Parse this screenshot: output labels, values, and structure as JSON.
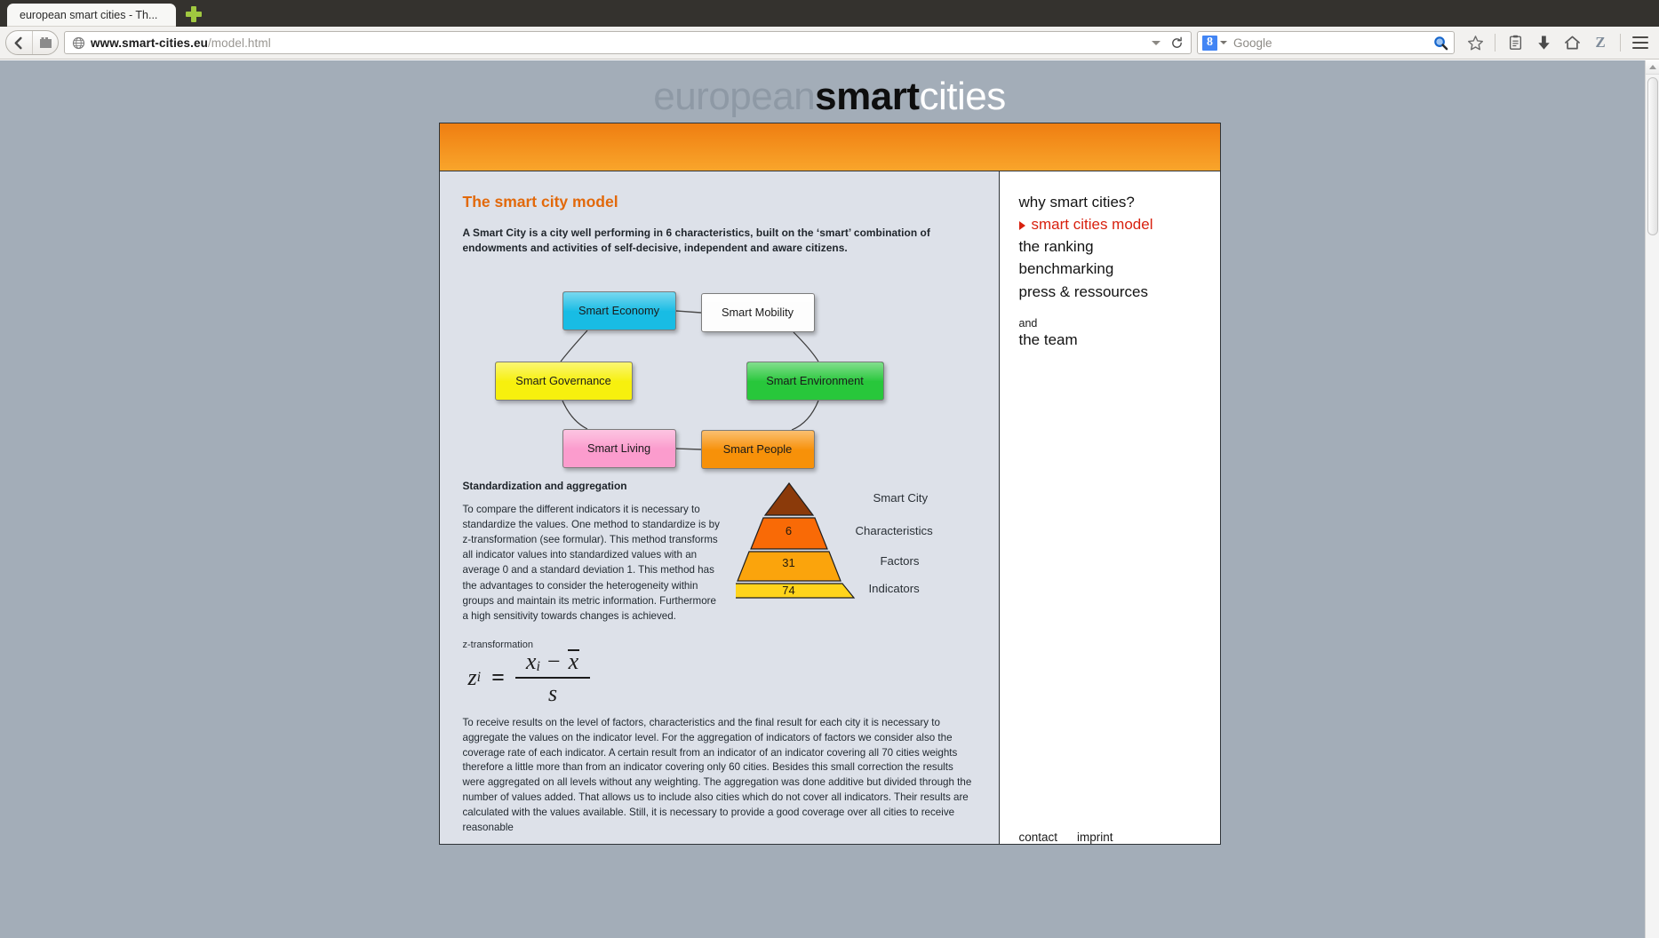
{
  "browser": {
    "tab_title": "european smart cities - Th...",
    "new_tab_label": "+",
    "url_host": "www.smart-cities.eu",
    "url_path": "/model.html",
    "search_engine": "Google",
    "search_placeholder": "Google",
    "icons": {
      "back": "back-arrow-icon",
      "site_identity": "site-identity-icon",
      "globe": "globe-icon",
      "reload": "reload-icon",
      "magnifier": "search-icon",
      "bookmark": "star-icon",
      "reading_list": "reading-list-icon",
      "downloads": "download-arrow-icon",
      "home": "home-icon",
      "zotero": "Z",
      "menu": "hamburger-menu-icon"
    }
  },
  "site": {
    "logo": {
      "part1": "european",
      "part2": "smart",
      "part3": "cities"
    }
  },
  "main": {
    "title": "The smart city model",
    "intro": "A Smart City is a city well performing in 6 characteristics, built on the ‘smart’ combination of endowments and activities of self-decisive, independent and aware citizens.",
    "diagram": {
      "nodes": [
        {
          "label": "Smart Economy",
          "color": "#18bce4"
        },
        {
          "label": "Smart Mobility",
          "color": "#fdfdfd"
        },
        {
          "label": "Smart Governance",
          "color": "#f7f00e"
        },
        {
          "label": "Smart Environment",
          "color": "#28c73b"
        },
        {
          "label": "Smart Living",
          "color": "#fb9ccd"
        },
        {
          "label": "Smart People",
          "color": "#f79109"
        }
      ]
    },
    "standardization": {
      "heading": "Standardization and aggregation",
      "paragraph": "To compare the different indicators it is necessary to standardize the values. One method to standardize is by z-transformation (see formular). This method transforms all indicator values into standardized values with an average 0 and a standard deviation 1. This method has the advantages to consider the heterogeneity within groups and maintain its metric information. Furthermore a high sensitivity towards changes is achieved."
    },
    "pyramid": {
      "levels": [
        {
          "value": "",
          "label": "Smart City",
          "color": "#8b3a0a"
        },
        {
          "value": "6",
          "label": "Characteristics",
          "color": "#f96a06"
        },
        {
          "value": "31",
          "label": "Factors",
          "color": "#fba40c"
        },
        {
          "value": "74",
          "label": "Indicators",
          "color": "#ffd41b"
        }
      ]
    },
    "formula": {
      "caption": "z-transformation",
      "z": "z",
      "z_sub": "i",
      "equals": "=",
      "numerator_x": "x",
      "numerator_sub": "i",
      "minus": "−",
      "numerator_mean": "x",
      "denominator": "s"
    },
    "tail_paragraph": "To receive results on the level of factors, characteristics and the final result for each city it is necessary to aggregate the values on the indicator level. For the aggregation of indicators of factors we consider also the coverage rate of each indicator. A certain result from an indicator of an indicator covering all 70 cities weights therefore a little more than from an indicator covering only 60 cities. Besides this small correction the results were aggregated on all levels without any weighting. The aggregation was done additive but divided through the number of values added. That allows us to include also cities which do not cover all indicators. Their results are calculated with the values available. Still, it is necessary to provide a good coverage over all cities to receive reasonable"
  },
  "sidebar": {
    "items": [
      {
        "label": "why smart cities?",
        "active": false
      },
      {
        "label": "smart cities model",
        "active": true
      },
      {
        "label": "the ranking",
        "active": false
      },
      {
        "label": "benchmarking",
        "active": false
      },
      {
        "label": "press & ressources",
        "active": false
      }
    ],
    "and_label": "and",
    "team_label": "the team",
    "footer": {
      "contact": "contact",
      "imprint": "imprint"
    }
  },
  "colors": {
    "accent_orange": "#e2690b",
    "banner_top": "#ef7e11",
    "banner_bottom": "#f9a52b",
    "active_red": "#d8210f",
    "page_bg": "#a3adb8",
    "content_bg": "#dde1e9"
  }
}
